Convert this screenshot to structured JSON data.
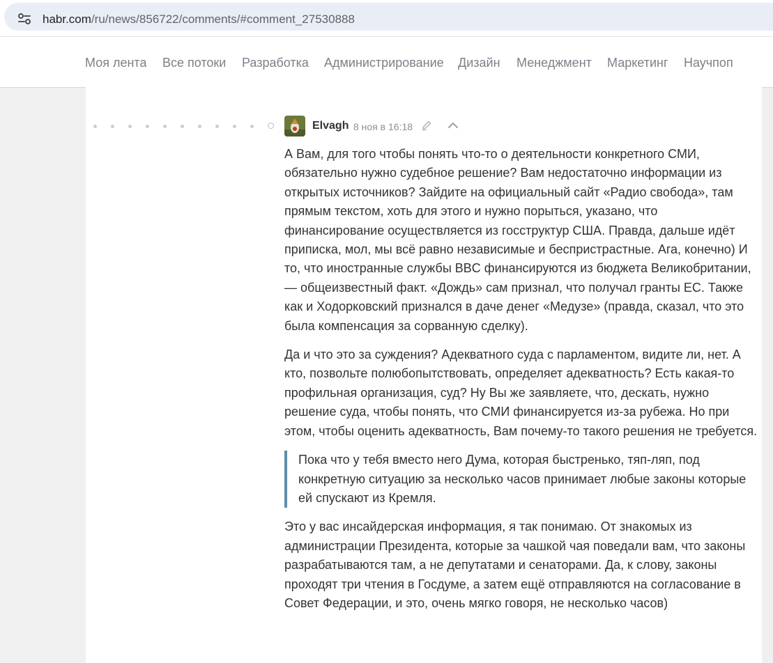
{
  "address_bar": {
    "url_host": "habr.com",
    "url_path": "/ru/news/856722/comments/#comment_27530888"
  },
  "nav": {
    "items": [
      {
        "label": "Моя лента"
      },
      {
        "label": "Все потоки"
      },
      {
        "label": "Разработка"
      },
      {
        "label": "Администрирование"
      },
      {
        "label": "Дизайн"
      },
      {
        "label": "Менеджмент"
      },
      {
        "label": "Маркетинг"
      },
      {
        "label": "Научпоп"
      }
    ]
  },
  "comment": {
    "author": "Elvagh",
    "timestamp": "8 ноя в 16:18",
    "paragraphs": [
      "А Вам, для того чтобы понять что-то о деятельности конкретного СМИ, обязательно нужно судебное решение? Вам недостаточно информации из открытых источников? Зайдите на официальный сайт «Радио свобода», там прямым текстом, хоть для этого и нужно порыться, указано, что финансирование осуществляется из госструктур США. Правда, дальше идёт приписка, мол, мы всё равно независимые и беспристрастные. Ага, конечно) И то, что иностранные службы BBC финансируются из бюджета Великобритании, — общеизвестный факт. «Дождь» сам признал, что получал гранты ЕС. Также как и Ходорковский признался в даче денег «Медузе» (правда, сказал, что это была компенсация за сорванную сделку).",
      "Да и что это за суждения? Адекватного суда с парламентом, видите ли, нет. А кто, позвольте полюбопытствовать, определяет адекватность? Есть какая-то профильная организация, суд? Ну Вы же заявляете, что, дескать, нужно решение суда, чтобы понять, что СМИ финансируется из-за рубежа. Но при этом, чтобы оценить адекватность, Вам почему-то такого решения не требуется."
    ],
    "quote": "Пока что у тебя вместо него Дума, которая быстренько, тяп-ляп, под конкретную ситуацию за несколько часов принимает любые законы которые ей спускают из Кремля.",
    "after_quote": "Это у вас инсайдерская информация, я так понимаю. От знакомых из администрации Президента, которые за чашкой чая поведали вам, что законы разрабатываются там, а не депутатами и сенаторами. Да, к слову, законы проходят три чтения в Госдуме, а затем ещё отправляются на согласование в Совет Федерации, и это, очень мягко говоря, не несколько часов)"
  },
  "icons": {
    "site_info": "tune-icon",
    "edit": "pencil-icon",
    "collapse": "chevron-up-icon",
    "accent_quote_border": "#5e8ea8"
  }
}
